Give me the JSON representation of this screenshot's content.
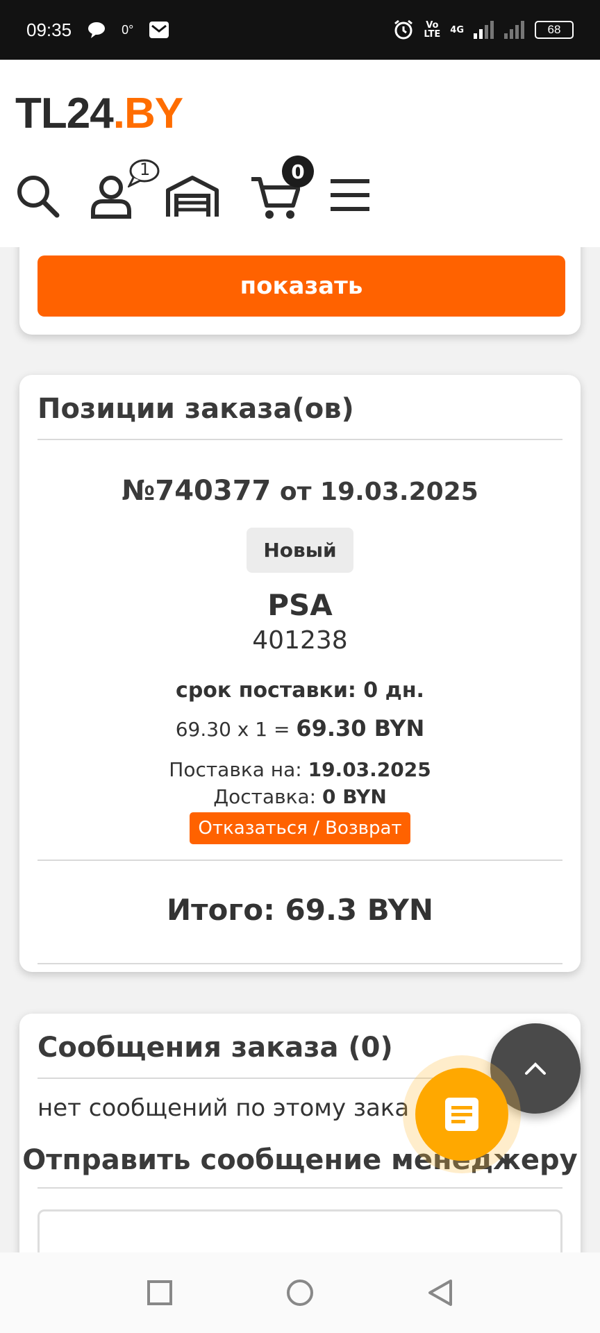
{
  "status_bar": {
    "time": "09:35",
    "temp": "0°",
    "network_top": "Vo",
    "network_bottom": "LTE",
    "signal_label": "4G",
    "battery": "68"
  },
  "header": {
    "logo_main": "TL24",
    "logo_dot_by": ".BY",
    "account_badge": "1",
    "cart_badge": "0"
  },
  "filter_card": {
    "show_button": "показать"
  },
  "order_items": {
    "title": "Позиции заказа(ов)",
    "order_number": "№740377",
    "order_from": " от 19.03.2025",
    "status": "Новый",
    "brand": "PSA",
    "article": "401238",
    "term": "срок поставки: 0 дн.",
    "price_calc": "69.30 x 1 = ",
    "price_total": "69.30 BYN",
    "supply_label": "Поставка на: ",
    "supply_date": "19.03.2025",
    "delivery_label": "Доставка: ",
    "delivery_value": "0 BYN",
    "refuse_button": "Отказаться / Возврат",
    "total": "Итого: 69.3 BYN"
  },
  "messages": {
    "title": "Сообщения заказа (0)",
    "empty_text": "нет сообщений по этому зака",
    "send_title": "Отправить сообщение менеджеру",
    "input_placeholder": ""
  }
}
